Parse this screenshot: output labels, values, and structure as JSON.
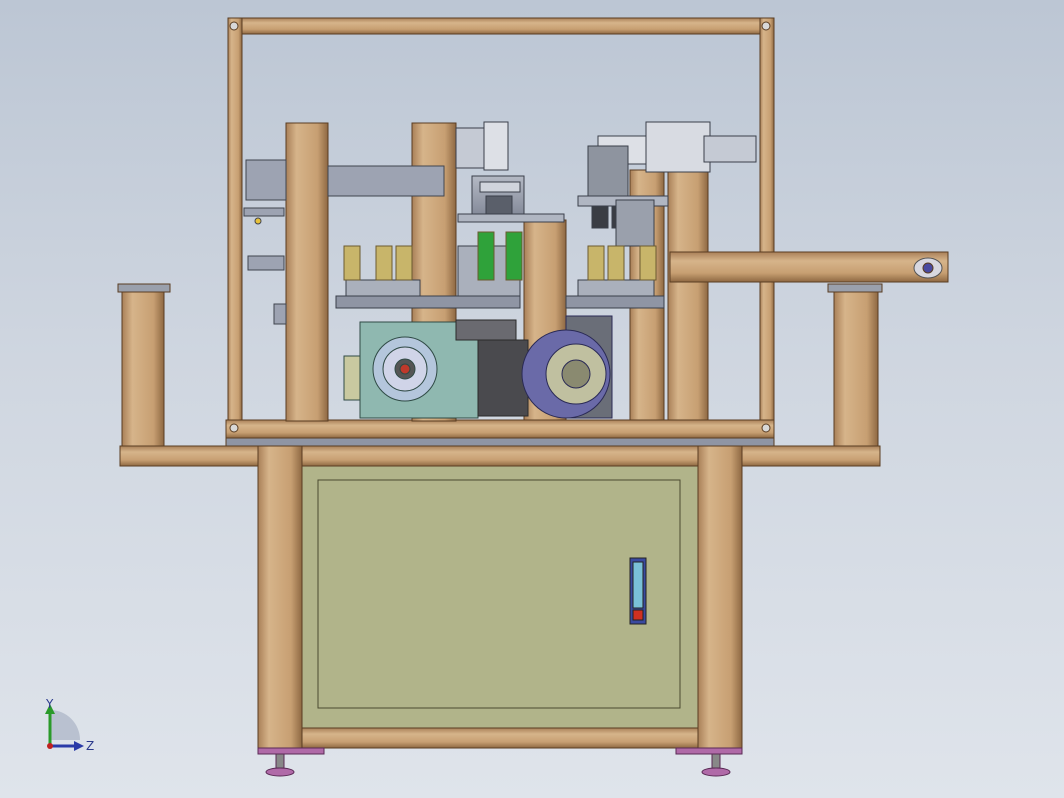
{
  "viewport": {
    "background_top": "#bcc6d4",
    "background_bottom": "#dfe4eb"
  },
  "colors": {
    "profile_face": "#c9a57a",
    "profile_edge": "#6b4a2a",
    "cabinet": "#b1b48a",
    "steel_plate": "#8f95a4",
    "gearbox": "#8fb8b0",
    "indexer": "#6a6aa8",
    "foot": "#b06aa8",
    "spring_green": "#2fa23a"
  },
  "view_triad": {
    "y_label": "Y",
    "z_label": "Z",
    "y_color": "#2a9a2a",
    "z_color": "#2a3aa8",
    "x_color": "#c02020"
  },
  "cabinet_gauge": {
    "icon": "level-gauge-icon"
  }
}
